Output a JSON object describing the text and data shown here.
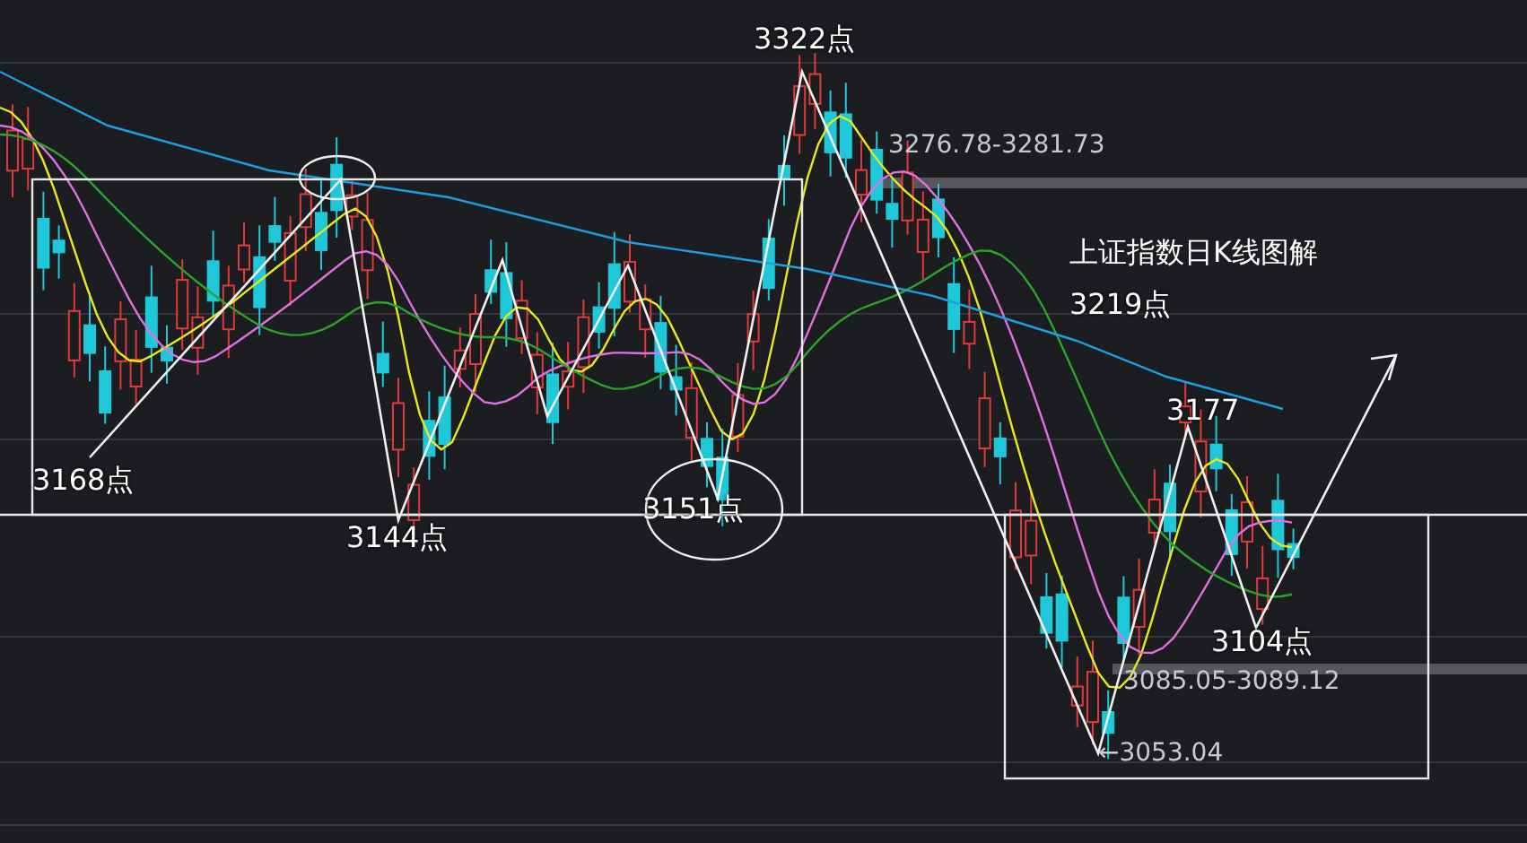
{
  "title": "上证指数日K线图解",
  "annotations": [
    {
      "kind": "point",
      "text": "3322点"
    },
    {
      "kind": "range",
      "text": "3276.78-3281.73"
    },
    {
      "kind": "point",
      "text": "3219点"
    },
    {
      "kind": "point",
      "text": "3177"
    },
    {
      "kind": "point",
      "text": "3168点"
    },
    {
      "kind": "point",
      "text": "3144点"
    },
    {
      "kind": "point",
      "text": "3151点"
    },
    {
      "kind": "point",
      "text": "3104点"
    },
    {
      "kind": "range",
      "text": "3085.05-3089.12"
    },
    {
      "kind": "range",
      "text": "←3053.04"
    }
  ]
}
